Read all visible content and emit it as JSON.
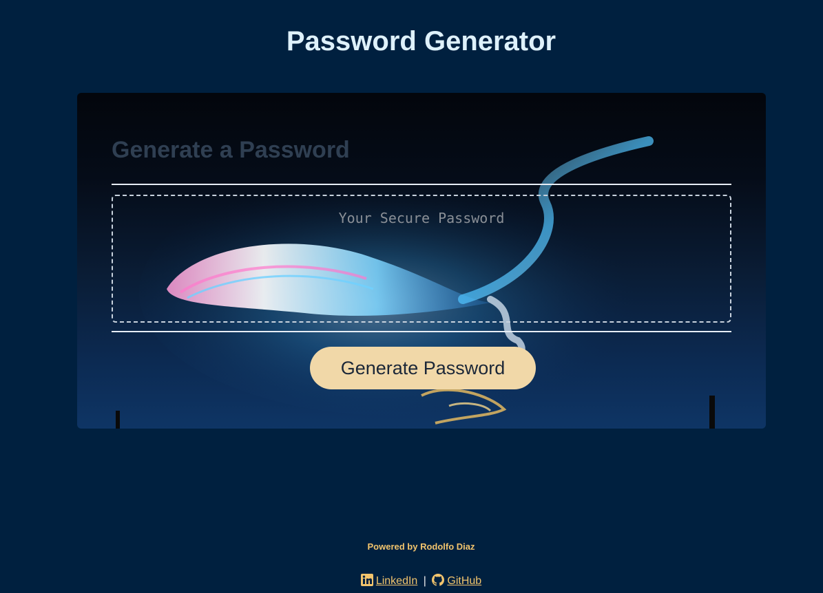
{
  "header": {
    "title": "Password Generator"
  },
  "card": {
    "heading": "Generate a Password",
    "password_placeholder": "Your Secure Password",
    "password_value": "",
    "generate_button_label": "Generate Password"
  },
  "footer": {
    "powered_by": "Powered by Rodolfo Diaz",
    "separator": "|",
    "links": [
      {
        "label": "LinkedIn",
        "icon": "linkedin-icon"
      },
      {
        "label": "GitHub",
        "icon": "github-icon"
      }
    ]
  },
  "colors": {
    "page_background": "#00203f",
    "title": "#def1fb",
    "button_background": "#f1d8a8",
    "footer_text": "#f2c46d"
  }
}
